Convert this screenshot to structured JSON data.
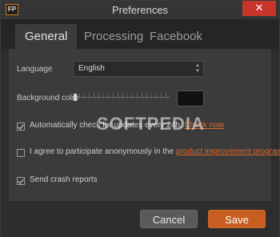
{
  "window": {
    "icon_text": "FP",
    "title": "Preferences",
    "close_label": "✕"
  },
  "tabs": [
    {
      "label": "General",
      "active": true
    },
    {
      "label": "Processing",
      "active": false
    },
    {
      "label": "Facebook",
      "active": false
    }
  ],
  "general": {
    "language_label": "Language",
    "language_value": "English",
    "background_color_label": "Background color",
    "background_swatch_color": "#111111",
    "check_updates": {
      "checked": true,
      "text": "Automatically check for updates every 24h.",
      "link": "Check now"
    },
    "participate": {
      "checked": false,
      "text": "I agree to participate anonymously in the",
      "link": "product improvement program."
    },
    "crash_reports": {
      "checked": true,
      "text": "Send crash reports"
    }
  },
  "footer": {
    "cancel_label": "Cancel",
    "save_label": "Save"
  },
  "watermark": "SOFTPEDIA",
  "colors": {
    "accent": "#c75d20",
    "link": "#e0682b",
    "close": "#c7352a"
  }
}
